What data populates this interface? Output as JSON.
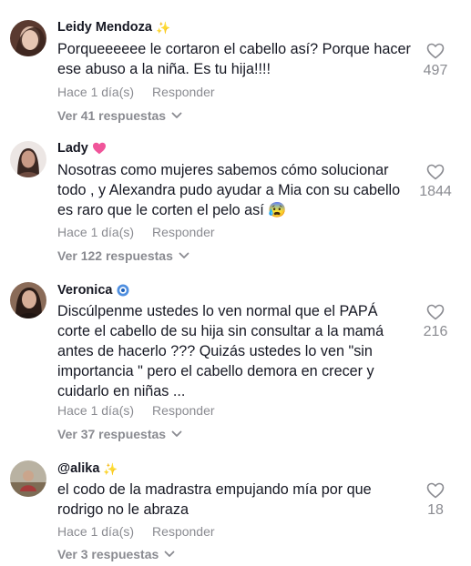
{
  "colors": {
    "text_primary": "#161823",
    "text_secondary": "#8a8b91",
    "heart_badge": "#fe2c55",
    "background": "#ffffff"
  },
  "comments": [
    {
      "username": "Leidy Mendoza",
      "badge_icon": "sparkles-icon",
      "badge": "✨",
      "text": "Porqueeeeee le cortaron el cabello así? Porque hacer ese abuso a la niña. Es tu hija!!!!",
      "time": "Hace 1 día(s)",
      "reply_label": "Responder",
      "view_replies": "Ver 41 respuestas",
      "likes": "497"
    },
    {
      "username": "Lady",
      "badge_icon": "pink-heart-icon",
      "badge": "💗",
      "text": "Nosotras como mujeres sabemos cómo solucionar todo , y Alexandra pudo ayudar a Mia con su cabello es raro que le corten el pelo así 😰",
      "time": "Hace 1 día(s)",
      "reply_label": "Responder",
      "view_replies": "Ver 122 respuestas",
      "likes": "1844"
    },
    {
      "username": "Veronica",
      "badge_icon": "blue-badge-icon",
      "badge": "🧿",
      "text": "Discúlpenme ustedes lo ven normal que el PAPÁ corte el cabello de su hija sin consultar a la mamá antes de hacerlo ??? Quizás ustedes lo ven \"sin importancia \" pero el cabello demora en crecer y cuidarlo en niñas ...",
      "time": "Hace 1 día(s)",
      "reply_label": "Responder",
      "view_replies": "Ver 37 respuestas",
      "likes": "216"
    },
    {
      "username": "@alika",
      "badge_icon": "sparkles-icon",
      "badge": "✨",
      "text": "el codo de la madrastra empujando mía por que rodrigo no le abraza",
      "time": "Hace 1 día(s)",
      "reply_label": "Responder",
      "view_replies": "Ver 3 respuestas",
      "likes": "18"
    }
  ]
}
